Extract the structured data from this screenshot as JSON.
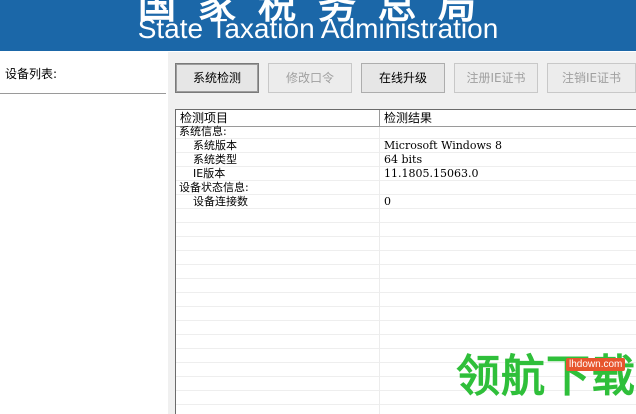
{
  "banner": {
    "title_cn": "国家税务总局",
    "title_en": "State Taxation Administration"
  },
  "device_list": {
    "label": "设备列表:"
  },
  "toolbar": {
    "buttons": [
      {
        "label": "系统检测",
        "enabled": true
      },
      {
        "label": "修改口令",
        "enabled": false
      },
      {
        "label": "在线升级",
        "enabled": true
      },
      {
        "label": "注册IE证书",
        "enabled": false
      },
      {
        "label": "注销IE证书",
        "enabled": false
      }
    ]
  },
  "results": {
    "columns": [
      "检测项目",
      "检测结果"
    ],
    "rows": [
      {
        "item": "系统信息:",
        "value": ""
      },
      {
        "item": "系统版本",
        "value": "Microsoft Windows 8"
      },
      {
        "item": "系统类型",
        "value": "64 bits"
      },
      {
        "item": "IE版本",
        "value": "11.1805.15063.0"
      },
      {
        "item": "设备状态信息:",
        "value": ""
      },
      {
        "item": "设备连接数",
        "value": "0"
      }
    ]
  },
  "watermark": {
    "text": "领航下载",
    "url": "lhdown.com"
  },
  "colors": {
    "banner": "#1b67a8",
    "watermark_green": "#2fbf3a",
    "watermark_badge": "#e7552d"
  }
}
